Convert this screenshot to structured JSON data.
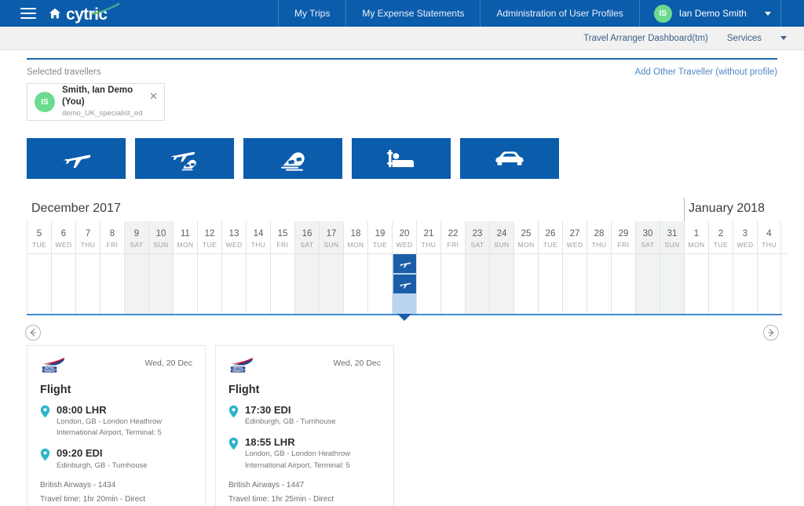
{
  "topbar": {
    "brand": "cytric",
    "menu_icon": "hamburger-icon",
    "home_icon": "home-icon",
    "nav": [
      {
        "label": "My Trips"
      },
      {
        "label": "My Expense Statements"
      },
      {
        "label": "Administration of User Profiles"
      }
    ],
    "user": {
      "initials": "IS",
      "name": "Ian Demo Smith",
      "avatar_color": "#6ddb8f"
    },
    "bg_color": "#0b5cab"
  },
  "subbar": {
    "items": [
      {
        "label": "Travel Arranger Dashboard(tm)"
      },
      {
        "label": "Services"
      }
    ]
  },
  "travellers": {
    "section_label": "Selected travellers",
    "add_link": "Add Other Traveller (without profile)",
    "selected": {
      "initials": "IS",
      "name": "Smith, Ian Demo (You)",
      "username": "demo_UK_specialist_ed",
      "remove_icon": "close-icon"
    }
  },
  "services": {
    "buttons": [
      {
        "name": "flight",
        "icon": "airplane-icon"
      },
      {
        "name": "flight-rail",
        "icon": "airplane-train-icon"
      },
      {
        "name": "rail",
        "icon": "train-icon"
      },
      {
        "name": "hotel",
        "icon": "bed-icon"
      },
      {
        "name": "car",
        "icon": "car-icon"
      }
    ],
    "bg_color": "#0b5cab"
  },
  "calendar": {
    "months": [
      {
        "label": "December 2017",
        "start_index": 0
      },
      {
        "label": "January 2018",
        "start_index": 27
      }
    ],
    "days": [
      {
        "num": "5",
        "dow": "TUE",
        "weekend": false
      },
      {
        "num": "6",
        "dow": "WED",
        "weekend": false
      },
      {
        "num": "7",
        "dow": "THU",
        "weekend": false
      },
      {
        "num": "8",
        "dow": "FRI",
        "weekend": false
      },
      {
        "num": "9",
        "dow": "SAT",
        "weekend": true
      },
      {
        "num": "10",
        "dow": "SUN",
        "weekend": true
      },
      {
        "num": "11",
        "dow": "MON",
        "weekend": false
      },
      {
        "num": "12",
        "dow": "TUE",
        "weekend": false
      },
      {
        "num": "13",
        "dow": "WED",
        "weekend": false
      },
      {
        "num": "14",
        "dow": "THU",
        "weekend": false
      },
      {
        "num": "15",
        "dow": "FRI",
        "weekend": false
      },
      {
        "num": "16",
        "dow": "SAT",
        "weekend": true
      },
      {
        "num": "17",
        "dow": "SUN",
        "weekend": true
      },
      {
        "num": "18",
        "dow": "MON",
        "weekend": false
      },
      {
        "num": "19",
        "dow": "TUE",
        "weekend": false
      },
      {
        "num": "20",
        "dow": "WED",
        "weekend": false,
        "selected": true,
        "events": 2
      },
      {
        "num": "21",
        "dow": "THU",
        "weekend": false
      },
      {
        "num": "22",
        "dow": "FRI",
        "weekend": false
      },
      {
        "num": "23",
        "dow": "SAT",
        "weekend": true
      },
      {
        "num": "24",
        "dow": "SUN",
        "weekend": true
      },
      {
        "num": "25",
        "dow": "MON",
        "weekend": false
      },
      {
        "num": "26",
        "dow": "TUE",
        "weekend": false
      },
      {
        "num": "27",
        "dow": "WED",
        "weekend": false
      },
      {
        "num": "28",
        "dow": "THU",
        "weekend": false
      },
      {
        "num": "29",
        "dow": "FRI",
        "weekend": false
      },
      {
        "num": "30",
        "dow": "SAT",
        "weekend": true
      },
      {
        "num": "31",
        "dow": "SUN",
        "weekend": true
      },
      {
        "num": "1",
        "dow": "MON",
        "weekend": false
      },
      {
        "num": "2",
        "dow": "TUE",
        "weekend": false
      },
      {
        "num": "3",
        "dow": "WED",
        "weekend": false
      },
      {
        "num": "4",
        "dow": "THU",
        "weekend": false
      }
    ],
    "event_icon": "airplane-icon",
    "selected_color": "#b9d4ef",
    "event_color": "#1b5ea8"
  },
  "carousel": {
    "prev_icon": "arrow-left-circle-icon",
    "next_icon": "arrow-right-circle-icon"
  },
  "cards": [
    {
      "airline_logo": "british-airways-logo",
      "date": "Wed, 20 Dec",
      "type": "Flight",
      "legs": [
        {
          "time": "08:00 LHR",
          "place_lines": [
            "London, GB - London Heathrow",
            "International Airport, Terminal: 5"
          ]
        },
        {
          "time": "09:20 EDI",
          "place_lines": [
            "Edinburgh, GB - Turnhouse"
          ]
        }
      ],
      "operator": "British Airways - 1434",
      "duration": "Travel time: 1hr 20min - Direct"
    },
    {
      "airline_logo": "british-airways-logo",
      "date": "Wed, 20 Dec",
      "type": "Flight",
      "legs": [
        {
          "time": "17:30 EDI",
          "place_lines": [
            "Edinburgh, GB - Turnhouse"
          ]
        },
        {
          "time": "18:55 LHR",
          "place_lines": [
            "London, GB - London Heathrow",
            "International Airport, Terminal: 5"
          ]
        }
      ],
      "operator": "British Airways - 1447",
      "duration": "Travel time: 1hr 25min - Direct"
    }
  ]
}
